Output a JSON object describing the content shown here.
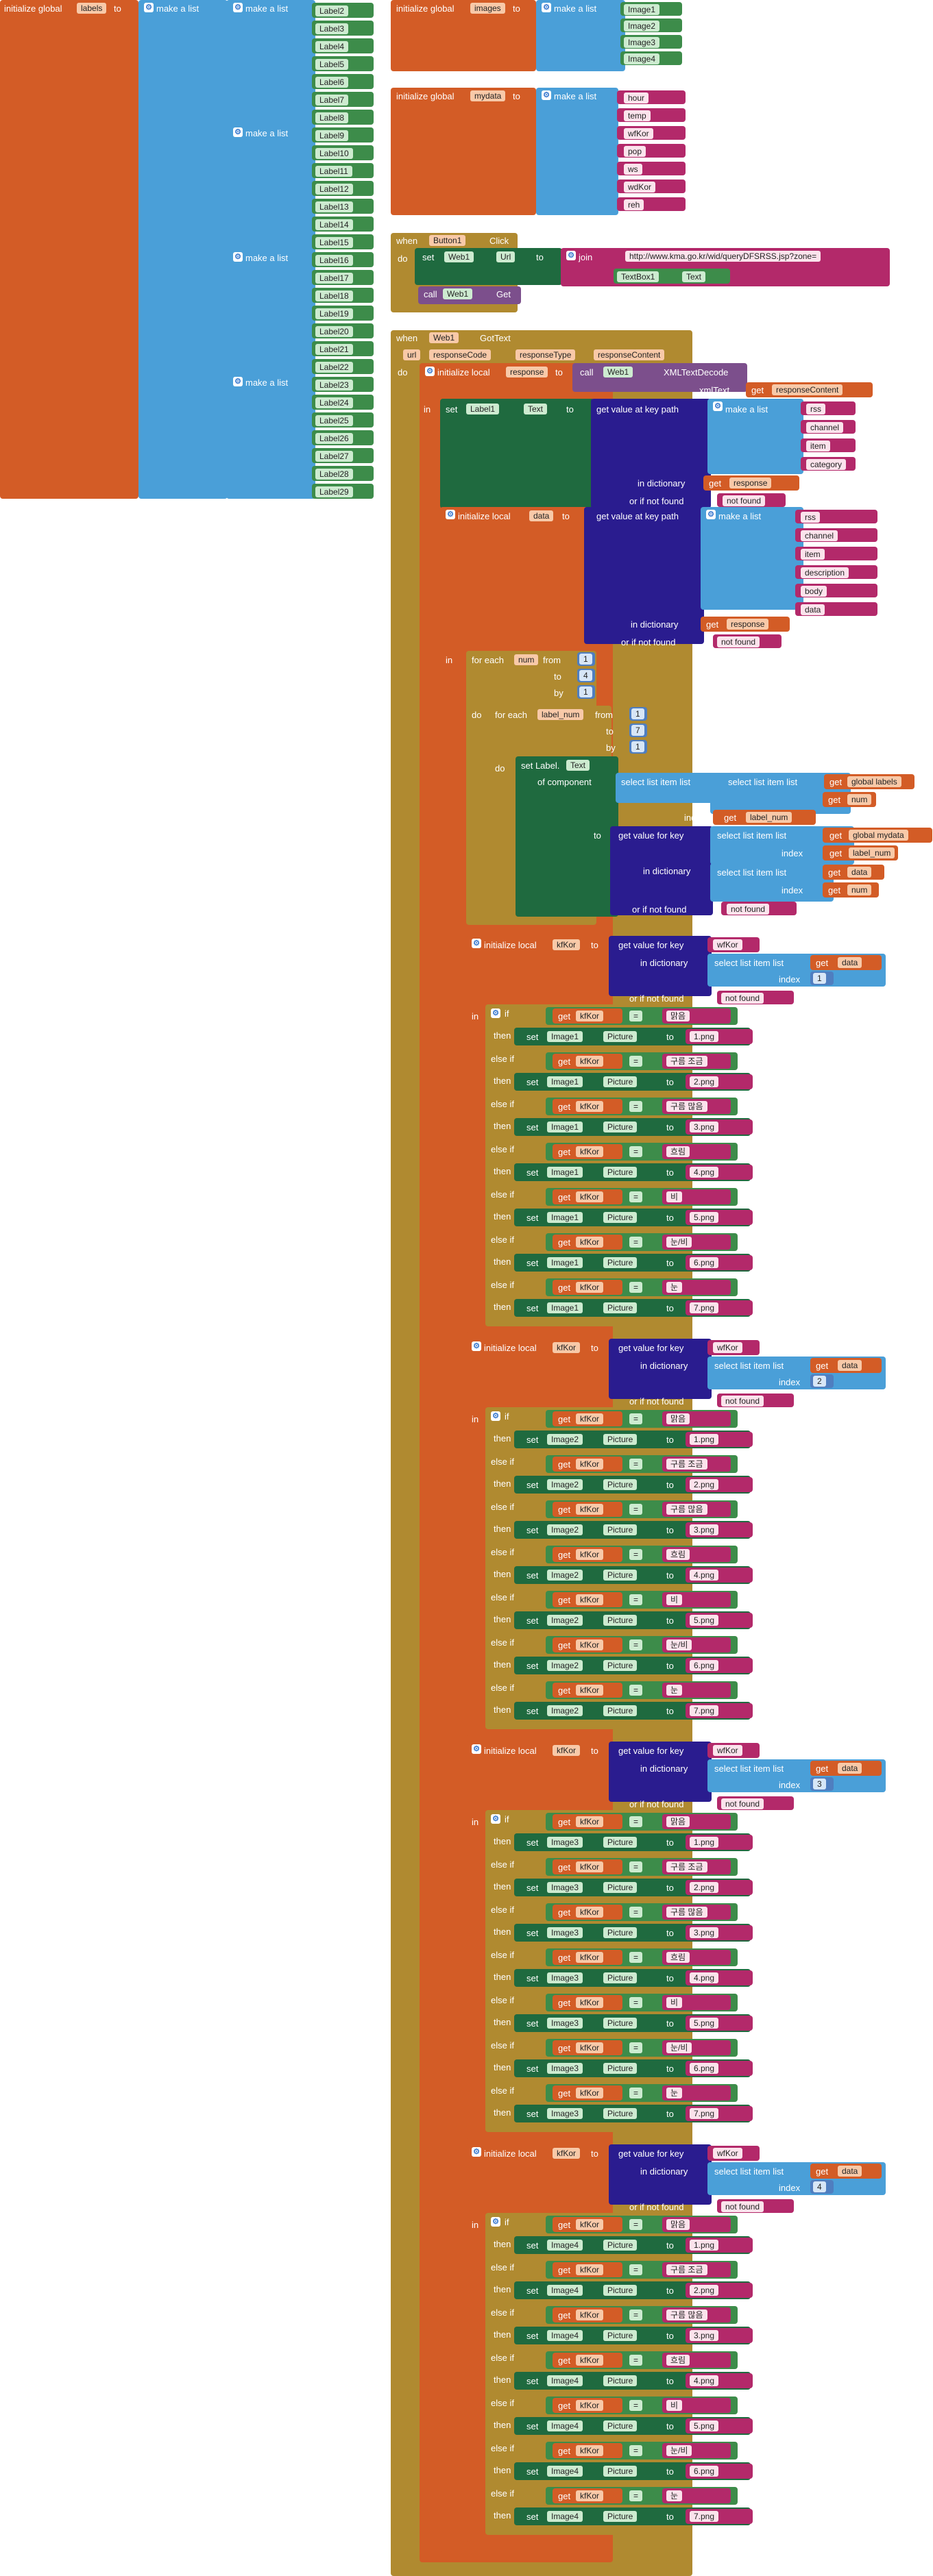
{
  "blocks": {
    "labels_global": {
      "prefix": "initialize global",
      "name": "labels",
      "to": "to",
      "make_list": "make a list"
    },
    "labels": [
      "Label2",
      "Label3",
      "Label4",
      "Label5",
      "Label6",
      "Label7",
      "Label8",
      "Label9",
      "Label10",
      "Label11",
      "Label12",
      "Label13",
      "Label14",
      "Label15",
      "Label16",
      "Label17",
      "Label18",
      "Label19",
      "Label20",
      "Label21",
      "Label22",
      "Label23",
      "Label24",
      "Label25",
      "Label26",
      "Label27",
      "Label28",
      "Label29"
    ],
    "images_global": {
      "prefix": "initialize global",
      "name": "images",
      "to": "to",
      "make_list": "make a list",
      "items": [
        "Image1",
        "Image2",
        "Image3",
        "Image4"
      ]
    },
    "mydata_global": {
      "prefix": "initialize global",
      "name": "mydata",
      "to": "to",
      "make_list": "make a list",
      "items": [
        "hour",
        "temp",
        "wfKor",
        "pop",
        "ws",
        "wdKor",
        "reh"
      ]
    },
    "button_click": {
      "when": "when",
      "component": "Button1",
      "event": "Click",
      "do": "do",
      "set": "set",
      "web": "Web1",
      "prop": "Url",
      "to": "to",
      "join": "join",
      "url": "http://www.kma.go.kr/wid/queryDFSRSS.jsp?zone=",
      "textbox": "TextBox1",
      "text_prop": "Text",
      "call": "call",
      "get_method": "Get"
    },
    "gottext": {
      "when": "when",
      "component": "Web1",
      "event": "GotText",
      "params": [
        "url",
        "responseCode",
        "responseType",
        "responseContent"
      ],
      "do": "do",
      "init_local": "initialize local",
      "response": "response",
      "to": "to",
      "call": "call",
      "decode": "XMLTextDecode",
      "xml_text": "xmlText",
      "get": "get",
      "response_content": "responseContent",
      "in": "in",
      "set": "set",
      "label1": "Label1",
      "text_prop": "Text",
      "get_value_path": "get value at key path",
      "make_list": "make a list",
      "path1": [
        "rss",
        "channel",
        "item",
        "category"
      ],
      "in_dictionary": "in dictionary",
      "or_if_not_found": "or if not found",
      "not_found": "not found",
      "data": "data",
      "path2": [
        "rss",
        "channel",
        "item",
        "description",
        "body",
        "data"
      ],
      "for_each": "for each",
      "num": "num",
      "from": "from",
      "to_kw": "to",
      "by": "by",
      "outer_from": "1",
      "outer_to": "4",
      "outer_by": "1",
      "label_num": "label_num",
      "inner_from": "1",
      "inner_to": "7",
      "inner_by": "1",
      "set_label": "set Label.",
      "of_component": "of component",
      "select_item": "select list item  list",
      "index": "index",
      "global_labels": "global labels",
      "global_mydata": "global mydata",
      "get_value_key": "get value for key",
      "wfkor": "wfKor",
      "kfkor": "kfKor",
      "if": "if",
      "then": "then",
      "else_if": "else if",
      "eq": "=",
      "picture": "Picture",
      "conditions": [
        "맑음",
        "구름 조금",
        "구름 많음",
        "흐림",
        "비",
        "눈/비",
        "눈"
      ],
      "images": [
        "1.png",
        "2.png",
        "3.png",
        "4.png",
        "5.png",
        "6.png",
        "7.png"
      ],
      "image_components": [
        "Image1",
        "Image2",
        "Image3",
        "Image4"
      ],
      "indices": [
        "1",
        "2",
        "3",
        "4"
      ]
    }
  },
  "colors": {
    "orange": "#d35c26",
    "blue": "#4a9fd8",
    "gold": "#b08a30",
    "green": "#1f6a3f",
    "purple": "#2a1c8f",
    "pink": "#b3296a"
  }
}
